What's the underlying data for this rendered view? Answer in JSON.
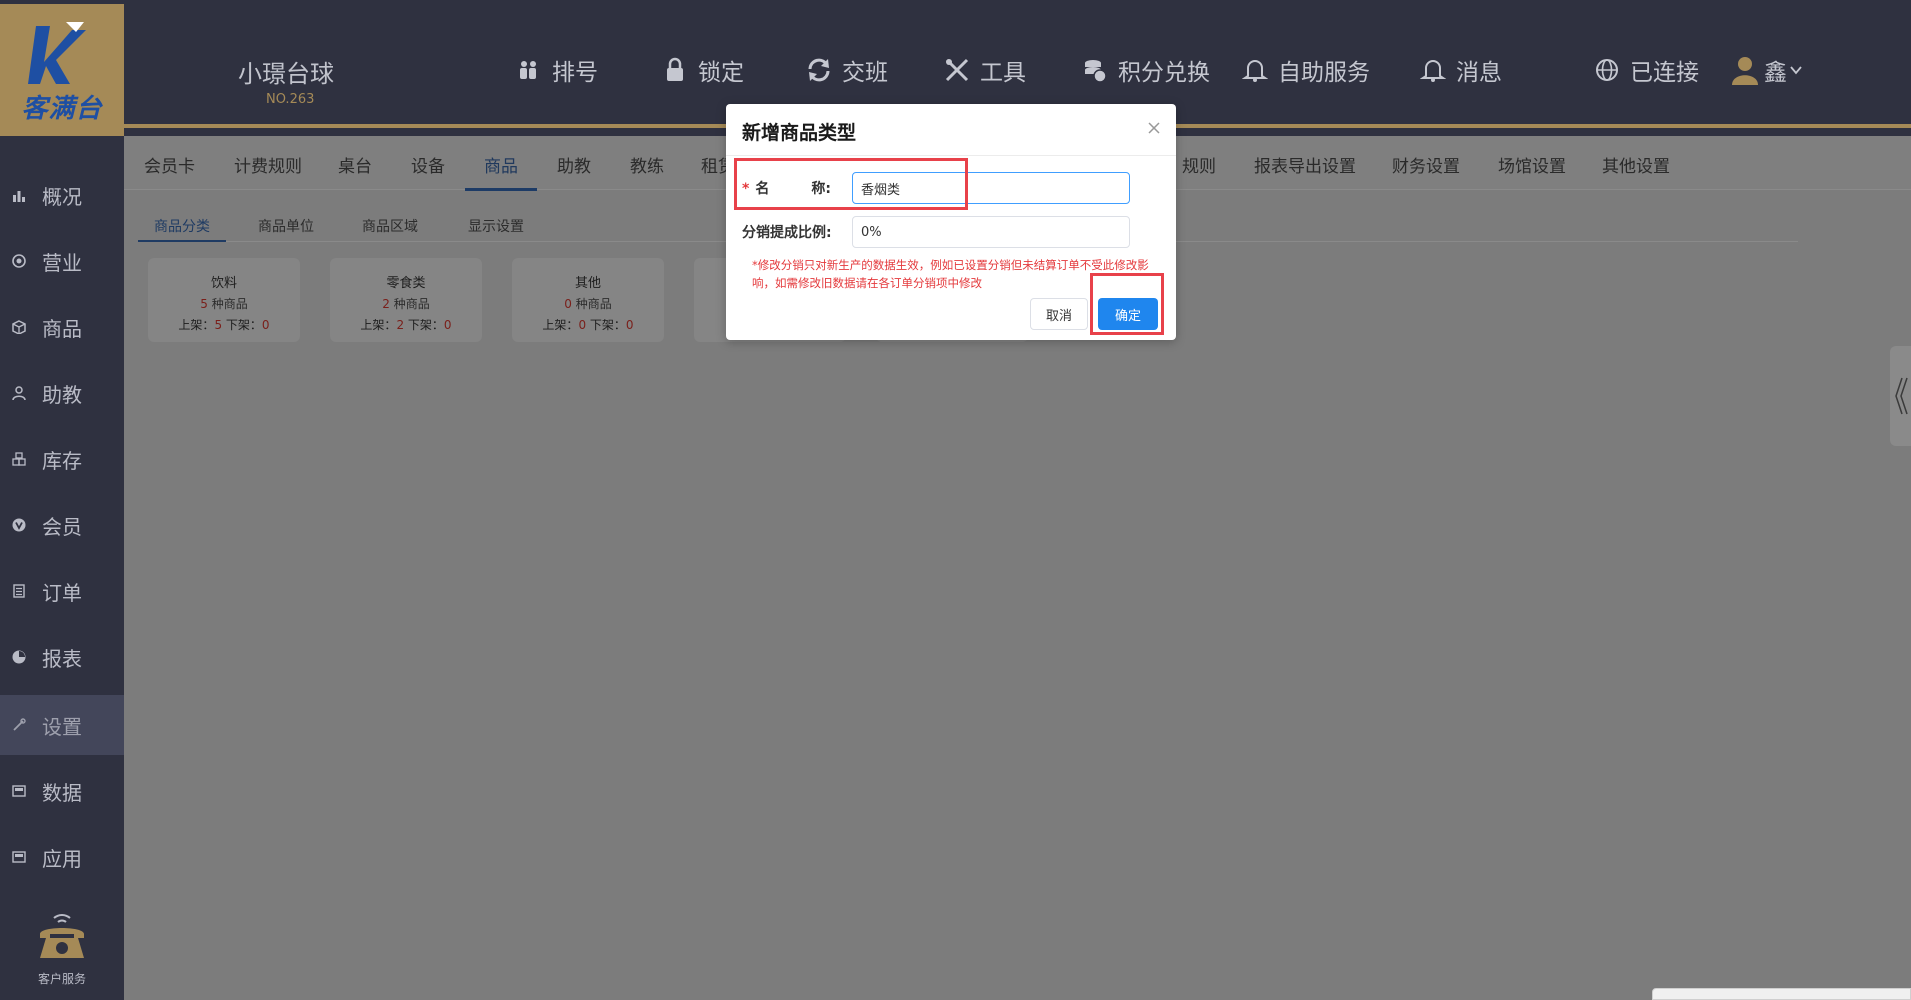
{
  "brand": {
    "logo_text": "客满台"
  },
  "sidebar": {
    "items": [
      {
        "label": "概况",
        "icon": "bar-chart-icon"
      },
      {
        "label": "营业",
        "icon": "circle-icon"
      },
      {
        "label": "商品",
        "icon": "box-icon"
      },
      {
        "label": "助教",
        "icon": "user-icon"
      },
      {
        "label": "库存",
        "icon": "warehouse-icon"
      },
      {
        "label": "会员",
        "icon": "vip-icon"
      },
      {
        "label": "订单",
        "icon": "document-icon"
      },
      {
        "label": "报表",
        "icon": "report-icon"
      },
      {
        "label": "设置",
        "icon": "wrench-icon"
      },
      {
        "label": "数据",
        "icon": "data-icon"
      },
      {
        "label": "应用",
        "icon": "app-icon"
      }
    ],
    "active_index": 8,
    "service_label": "客户服务"
  },
  "header": {
    "venue_name": "小璟台球",
    "venue_no": "NO.263",
    "menu": [
      {
        "label": "排号",
        "icon": "people-icon"
      },
      {
        "label": "锁定",
        "icon": "lock-icon"
      },
      {
        "label": "交班",
        "icon": "refresh-icon"
      },
      {
        "label": "工具",
        "icon": "tools-icon"
      },
      {
        "label": "积分兑换",
        "icon": "coins-icon"
      },
      {
        "label": "自助服务",
        "icon": "bell-icon"
      },
      {
        "label": "消息",
        "icon": "bell-outline-icon"
      },
      {
        "label": "已连接",
        "icon": "globe-icon"
      },
      {
        "label": "鑫",
        "icon": "user-avatar-icon"
      }
    ]
  },
  "tabs": {
    "items": [
      "会员卡",
      "计费规则",
      "桌台",
      "设备",
      "商品",
      "助教",
      "教练",
      "租赁",
      "规则",
      "报表导出设置",
      "财务设置",
      "场馆设置",
      "其他设置"
    ],
    "active": "商品"
  },
  "subtabs": {
    "items": [
      "商品分类",
      "商品单位",
      "商品区域",
      "显示设置"
    ],
    "active": "商品分类"
  },
  "categories": [
    {
      "name": "饮料",
      "count": "5",
      "count_suffix": "种商品",
      "on_label": "上架：",
      "on": "5",
      "off_label": "下架：",
      "off": "0"
    },
    {
      "name": "零食类",
      "count": "2",
      "count_suffix": "种商品",
      "on_label": "上架：",
      "on": "2",
      "off_label": "下架：",
      "off": "0"
    },
    {
      "name": "其他",
      "count": "0",
      "count_suffix": "种商品",
      "on_label": "上架：",
      "on": "0",
      "off_label": "下架：",
      "off": "0"
    }
  ],
  "modal": {
    "title": "新增商品类型",
    "name_label": "名　　　称:",
    "name_value": "香烟类",
    "ratio_label": "分销提成比例:",
    "ratio_value": "0%",
    "hint": "*修改分销只对新生产的数据生效，例如已设置分销但未结算订单不受此修改影响，如需修改旧数据请在各订单分销项中修改",
    "cancel_label": "取消",
    "confirm_label": "确定"
  },
  "colors": {
    "sidebar_bg": "#2f3140",
    "brand_gold": "#a58a57",
    "overlay": "#7c7c7c",
    "primary": "#1f86ee",
    "danger": "#e4393c",
    "annotation": "#e8414a"
  }
}
